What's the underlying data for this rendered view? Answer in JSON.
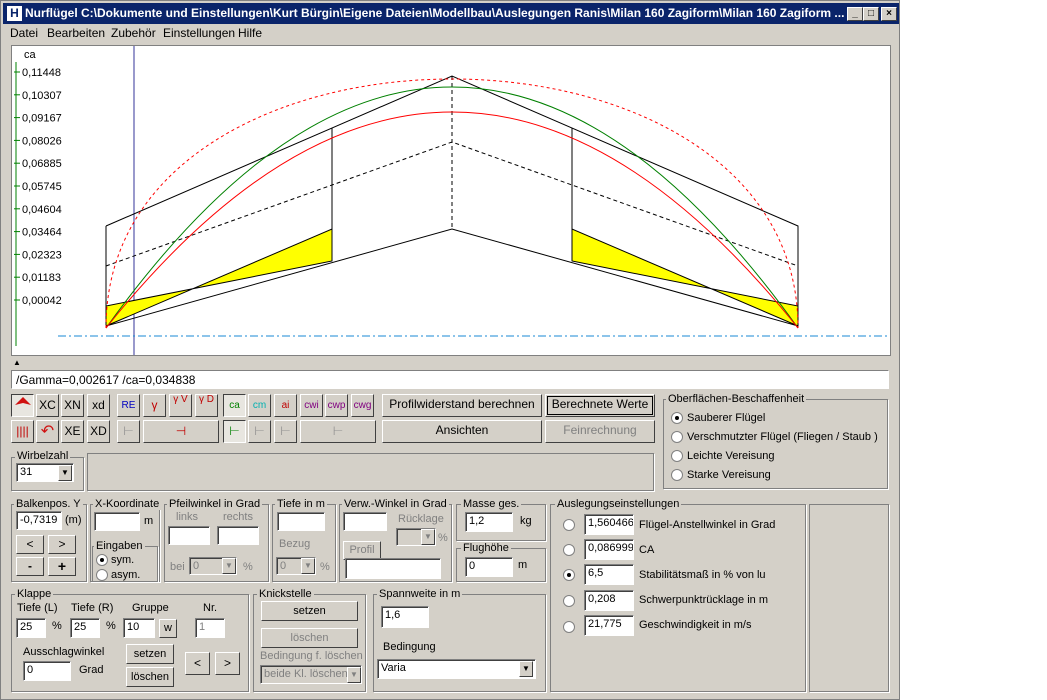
{
  "window": {
    "title": "Nurflügel  C:\\Dokumente und Einstellungen\\Kurt Bürgin\\Eigene Dateien\\Modellbau\\Auslegungen Ranis\\Milan 160 Zagiform\\Milan 160 Zagiform ...",
    "app_icon": "H",
    "minimize": "_",
    "maximize": "□",
    "close": "×"
  },
  "menu": [
    "Datei",
    "Bearbeiten",
    "Zubehör",
    "Einstellungen",
    "Hilfe"
  ],
  "chart_data": {
    "type": "line",
    "ylabel": "ca",
    "yticks": [
      "0,11448",
      "0,10307",
      "0,09167",
      "0,08026",
      "0,06885",
      "0,05745",
      "0,04604",
      "0,03464",
      "0,02323",
      "0,01183",
      "0,00042"
    ],
    "series": [
      {
        "color": "#008000",
        "style": "solid"
      },
      {
        "color": "#ff0000",
        "style": "solid"
      },
      {
        "color": "#ff0000",
        "style": "dashed"
      }
    ]
  },
  "status": "/Gamma=0,002617 /ca=0,034838",
  "toolbar": {
    "row1": [
      {
        "id": "wing",
        "label": ""
      },
      {
        "id": "xc",
        "label": "XC"
      },
      {
        "id": "xn",
        "label": "XN"
      },
      {
        "id": "xd",
        "label": "xd"
      },
      {
        "id": "re",
        "label": "RE"
      },
      {
        "id": "gamma",
        "label": "γ"
      },
      {
        "id": "gamma-v",
        "label": "γ V"
      },
      {
        "id": "gamma-d",
        "label": "γ D"
      },
      {
        "id": "ca",
        "label": "ca"
      },
      {
        "id": "cm",
        "label": "cm"
      },
      {
        "id": "ai",
        "label": "ai"
      },
      {
        "id": "cwi",
        "label": "cwi"
      },
      {
        "id": "cwp",
        "label": "cwp"
      },
      {
        "id": "cwg",
        "label": "cwg"
      }
    ],
    "row2": [
      {
        "id": "ribs",
        "label": ""
      },
      {
        "id": "undo",
        "label": "↶"
      },
      {
        "id": "xe",
        "label": "XE"
      },
      {
        "id": "xd2",
        "label": "XD"
      }
    ],
    "profilwiderstand": "Profilwiderstand berechnen",
    "berechnete_werte": "Berechnete Werte",
    "ansichten": "Ansichten",
    "feinrechnung": "Feinrechnung"
  },
  "surface": {
    "title": "Oberflächen-Beschaffenheit",
    "options": [
      "Sauberer Flügel",
      "Verschmutzter Flügel (Fliegen / Staub )",
      "Leichte Vereisung",
      "Starke Vereisung"
    ],
    "selected": 0
  },
  "wirbelzahl": {
    "title": "Wirbelzahl",
    "value": "31"
  },
  "balkenpos": {
    "title": "Balkenpos. Y",
    "value": "-0,7319",
    "unit": "(m)",
    "left": "<",
    "right": ">",
    "minus": "-",
    "plus": "+"
  },
  "xkoord": {
    "title": "X-Koordinate",
    "value": "",
    "unit": "m"
  },
  "eingaben": {
    "title": "Eingaben",
    "sym": "sym.",
    "asym": "asym."
  },
  "pfeil": {
    "title": "Pfeilwinkel in Grad",
    "links": "links",
    "rechts": "rechts",
    "bei": "bei",
    "bei_value": "0",
    "unit": "%"
  },
  "tiefe": {
    "title": "Tiefe in m",
    "bezug": "Bezug",
    "bezug_value": "0",
    "unit": "%"
  },
  "verw": {
    "title": "Verw.-Winkel in Grad",
    "ruecklage": "Rücklage",
    "unit": "%",
    "profil": "Profil"
  },
  "masse": {
    "title": "Masse  ges.",
    "value": "1,2",
    "unit": "kg"
  },
  "flughoehe": {
    "title": "Flughöhe",
    "value": "0",
    "unit": "m"
  },
  "klappe": {
    "title": "Klappe",
    "tiefe_l": "Tiefe (L)",
    "tiefe_l_value": "25",
    "tiefe_r": "Tiefe (R)",
    "tiefe_r_value": "25",
    "gruppe": "Gruppe",
    "gruppe_value": "10",
    "w": "w",
    "nr": "Nr.",
    "nr_value": "1",
    "pct": "%",
    "ausschlag": "Ausschlagwinkel",
    "ausschlag_value": "0",
    "grad": "Grad",
    "setzen": "setzen",
    "loeschen": "löschen",
    "prev": "<",
    "next": ">"
  },
  "knick": {
    "title": "Knickstelle",
    "setzen": "setzen",
    "loeschen": "löschen",
    "bedingung": "Bedingung f. löschen",
    "bedingung_value": "beide Kl. löschen"
  },
  "spannweite": {
    "title": "Spannweite in m",
    "value": "1,6",
    "bedingung": "Bedingung",
    "bedingung_value": "Varia"
  },
  "auslegung": {
    "title": "Auslegungseinstellungen",
    "rows": [
      {
        "value": "1,560466",
        "label": "Flügel-Anstellwinkel in Grad"
      },
      {
        "value": "0,086999",
        "label": "CA"
      },
      {
        "value": "6,5",
        "label": "Stabilitätsmaß in % von lu"
      },
      {
        "value": "0,208",
        "label": "Schwerpunktrücklage in m"
      },
      {
        "value": "21,775",
        "label": "Geschwindigkeit in m/s"
      }
    ],
    "selected": 2
  }
}
